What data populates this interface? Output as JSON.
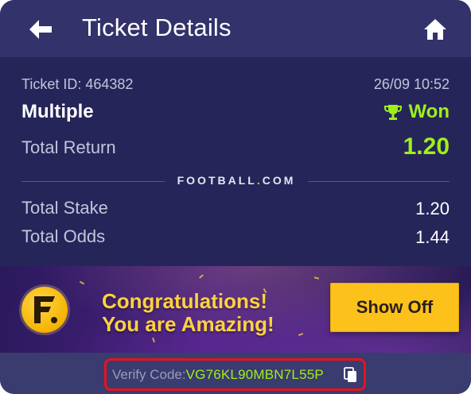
{
  "header": {
    "title": "Ticket Details",
    "back_icon": "back-arrow-icon",
    "home_icon": "home-icon"
  },
  "ticket": {
    "id_text": "Ticket ID: 464382",
    "datetime": "26/09 10:52",
    "bet_type": "Multiple",
    "status": "Won",
    "status_icon": "trophy-icon",
    "total_return_label": "Total Return",
    "total_return_value": "1.20",
    "brand_prefix": "FOOTBALL",
    "brand_dot": ".",
    "brand_suffix": "COM",
    "total_stake_label": "Total Stake",
    "total_stake_value": "1.20",
    "total_odds_label": "Total Odds",
    "total_odds_value": "1.44"
  },
  "banner": {
    "logo_letter": "F",
    "line1": "Congratulations!",
    "line2": "You are Amazing!",
    "button_label": "Show Off"
  },
  "footer": {
    "verify_label": "Verify Code:",
    "verify_code": "VG76KL90MBN7L55P",
    "copy_icon": "copy-icon"
  },
  "colors": {
    "background": "#262559",
    "header": "#33326b",
    "accent_green": "#9ef01a",
    "button_yellow": "#fcc21b",
    "highlight_red": "#e8131a"
  }
}
